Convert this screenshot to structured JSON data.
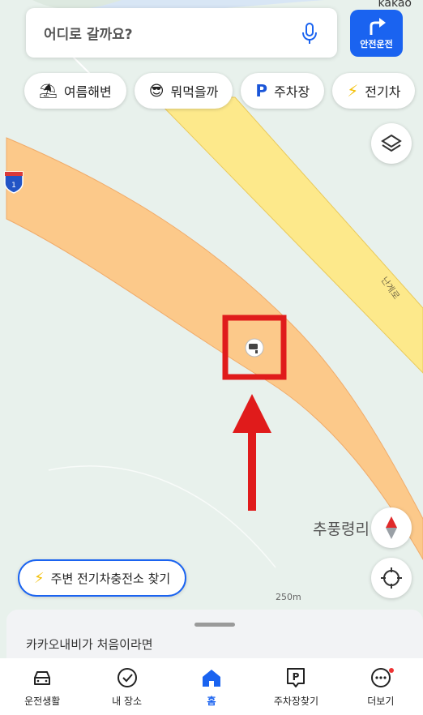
{
  "brand": "kakao",
  "search": {
    "placeholder": "어디로 갈까요?"
  },
  "drive_button": {
    "label": "안전운전"
  },
  "chips": [
    {
      "icon": "beach-umbrella-icon",
      "label": "여름해변"
    },
    {
      "icon": "sunglasses-face-icon",
      "label": "뭐먹을까"
    },
    {
      "icon": "parking-icon",
      "label": "주차장"
    },
    {
      "icon": "lightning-icon",
      "label": "전기차"
    }
  ],
  "map": {
    "road_shield": "1",
    "road_name": "난계로",
    "place_name": "추풍령리",
    "scale": "250m",
    "colors": {
      "highway": "#fcc98a",
      "road": "#fde98b",
      "ground": "#e8f1ec",
      "highlight": "#e01b1b"
    }
  },
  "ev_button": {
    "label": "주변 전기차충전소 찾기"
  },
  "sheet": {
    "title": "카카오내비가 처음이라면"
  },
  "tabs": [
    {
      "icon": "car-icon",
      "label": "운전생활"
    },
    {
      "icon": "check-circle-icon",
      "label": "내 장소"
    },
    {
      "icon": "home-icon",
      "label": "홈",
      "active": true
    },
    {
      "icon": "parking-sign-icon",
      "label": "주차장찾기"
    },
    {
      "icon": "more-dots-icon",
      "label": "더보기"
    }
  ]
}
